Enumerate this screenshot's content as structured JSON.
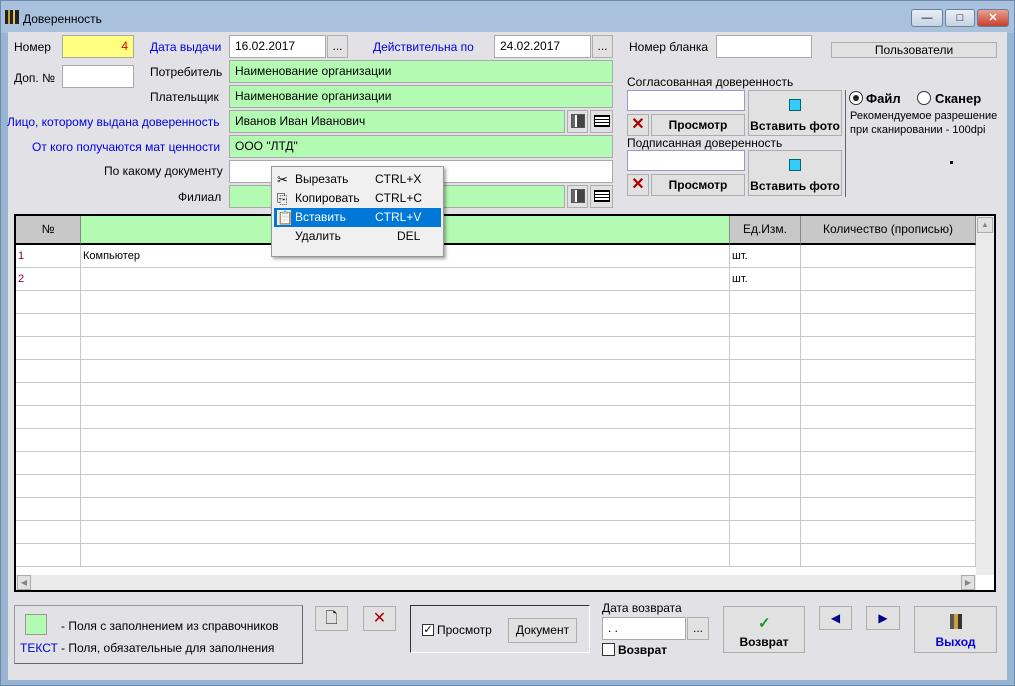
{
  "window": {
    "title": "Доверенность",
    "minimize": "—",
    "maximize": "□",
    "close": "✕"
  },
  "form": {
    "nomer_label": "Номер",
    "nomer_value": "4",
    "dop_label": "Доп. №",
    "dop_value": "",
    "date_issue_label": "Дата выдачи",
    "date_issue_value": "16.02.2017",
    "valid_until_label": "Действительна по",
    "valid_until_value": "24.02.2017",
    "picker": "...",
    "blank_label": "Номер бланка",
    "blank_value": "",
    "users_button": "Пользователи",
    "consumer_label": "Потребитель",
    "consumer_value": "Наименование организации",
    "payer_label": "Плательщик",
    "payer_value": "Наименование организации",
    "person_label": "Лицо, которому выдана доверенность",
    "person_value": "Иванов Иван Иванович",
    "from_label": "От кого получаются мат ценности",
    "from_value": "ООО \"ЛТД\"",
    "doc_label": "По какому документу",
    "doc_value": "",
    "branch_label": "Филиал",
    "branch_value": ""
  },
  "scan": {
    "agreed_label": "Согласованная доверенность",
    "signed_label": "Подписанная доверенность",
    "view_button": "Просмотр",
    "insert_photo_button": "Вставить фото",
    "radio_file": "Файл",
    "radio_scanner": "Сканер",
    "selected": "Файл",
    "hint_line1": "Рекомендуемое разрешение",
    "hint_line2": "при сканировании - 100dpi"
  },
  "table": {
    "columns": [
      "№",
      "",
      "Ед.Изм.",
      "Количество (прописью)"
    ],
    "rows": [
      {
        "n": "1",
        "name": "Компьютер",
        "unit": "шт.",
        "qty": ""
      },
      {
        "n": "2",
        "name": "",
        "unit": "шт.",
        "qty": ""
      }
    ]
  },
  "context_menu": {
    "items": [
      {
        "label": "Вырезать",
        "shortcut": "CTRL+X",
        "icon": "scissors-icon"
      },
      {
        "label": "Копировать",
        "shortcut": "CTRL+C",
        "icon": "copy-icon"
      },
      {
        "label": "Вставить",
        "shortcut": "CTRL+V",
        "icon": "paste-icon",
        "highlighted": true
      },
      {
        "label": "Удалить",
        "shortcut": "DEL"
      }
    ]
  },
  "legend": {
    "green_text": "- Поля с заполнением из справочников",
    "blue_sample": "ТЕКСТ",
    "blue_text": "- Поля, обязательные для заполнения"
  },
  "footer": {
    "preview_checkbox": "Просмотр",
    "preview_checked": true,
    "document_button": "Документ",
    "return_date_label": "Дата возврата",
    "return_date_value": " . .",
    "return_checkbox": "Возврат",
    "return_checked": false,
    "return_button": "Возврат",
    "exit_button": "Выход"
  },
  "colors": {
    "required_label": "#0000e0",
    "lookup_field": "#b3fbb3",
    "number_field": "#ffff80",
    "highlight": "#0078d7"
  }
}
